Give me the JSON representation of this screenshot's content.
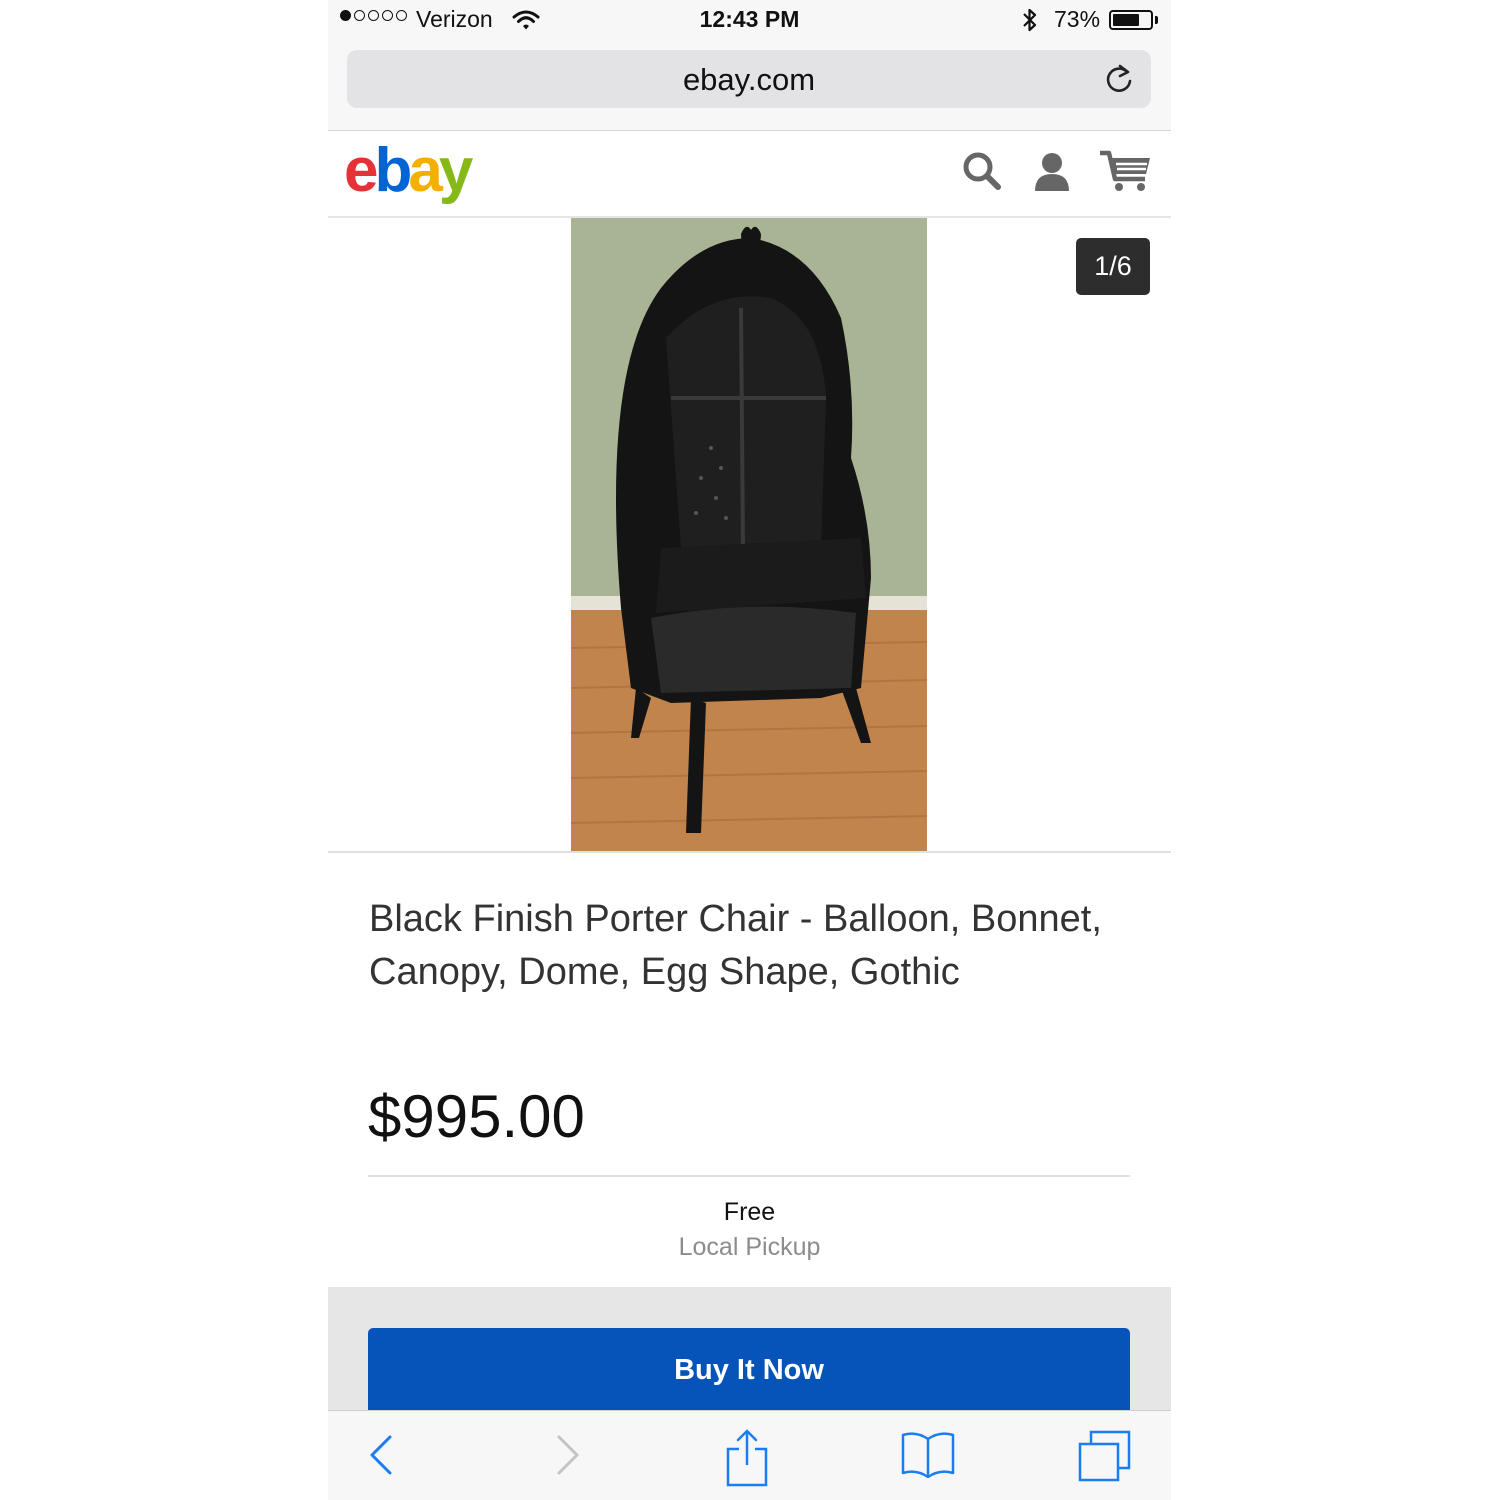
{
  "status_bar": {
    "carrier": "Verizon",
    "time": "12:43 PM",
    "battery_percent": "73%",
    "battery_level": 0.73,
    "signal_bars_filled": 1,
    "signal_bars_total": 5
  },
  "browser": {
    "url": "ebay.com"
  },
  "header": {
    "logo": {
      "e": "e",
      "b": "b",
      "a": "a",
      "y": "y"
    },
    "icons": [
      "search-icon",
      "account-icon",
      "cart-icon"
    ]
  },
  "gallery": {
    "counter": "1/6"
  },
  "listing": {
    "title": "Black Finish Porter Chair - Balloon, Bonnet, Canopy, Dome, Egg Shape, Gothic",
    "price": "$995.00",
    "shipping_cost": "Free",
    "shipping_method": "Local Pickup",
    "buy_label": "Buy It Now"
  },
  "toolbar": {
    "icons": [
      "back-icon",
      "forward-icon",
      "share-icon",
      "bookmarks-icon",
      "tabs-icon"
    ]
  },
  "colors": {
    "ebay_red": "#e53238",
    "ebay_blue": "#0064d2",
    "ebay_yellow": "#f5af02",
    "ebay_green": "#86b817",
    "buy_button": "#0654ba",
    "ios_blue": "#1a7ef2"
  }
}
